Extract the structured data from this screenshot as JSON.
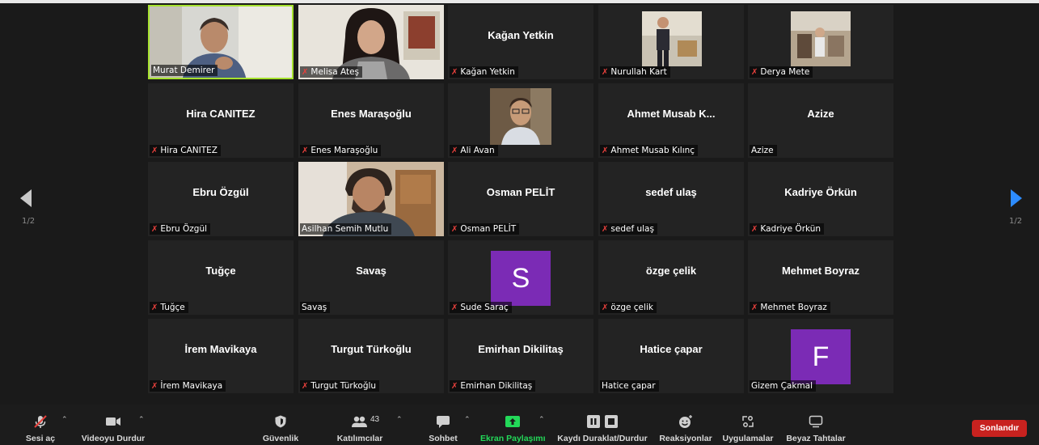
{
  "pagination": {
    "left": "1/2",
    "right": "1/2"
  },
  "tiles": [
    {
      "name": "Murat Demirer",
      "label": "Murat Demirer",
      "muted": false,
      "video": true,
      "active": true
    },
    {
      "name": "Melisa Ateş",
      "label": "Melisa Ateş",
      "muted": true,
      "video": true
    },
    {
      "name": "Kağan Yetkin",
      "label": "Kağan Yetkin",
      "muted": true,
      "video": false
    },
    {
      "name": "Nurullah Kart",
      "label": "Nurullah Kart",
      "muted": true,
      "video": true
    },
    {
      "name": "Derya Mete",
      "label": "Derya Mete",
      "muted": true,
      "video": true
    },
    {
      "name": "Hira CANITEZ",
      "label": "Hira CANITEZ",
      "muted": true,
      "video": false
    },
    {
      "name": "Enes Maraşoğlu",
      "label": "Enes Maraşoğlu",
      "muted": true,
      "video": false
    },
    {
      "name": "Ali Avan",
      "label": "Ali Avan",
      "muted": true,
      "video": true
    },
    {
      "name": "Ahmet Musab K...",
      "label": "Ahmet Musab Kılınç",
      "muted": true,
      "video": false
    },
    {
      "name": "Azize",
      "label": "Azize",
      "muted": false,
      "video": false
    },
    {
      "name": "Ebru Özgül",
      "label": "Ebru Özgül",
      "muted": true,
      "video": false
    },
    {
      "name": "Asilhan Semih Mutlu",
      "label": "Asilhan Semih Mutlu",
      "muted": false,
      "video": true
    },
    {
      "name": "Osman PELİT",
      "label": "Osman PELİT",
      "muted": true,
      "video": false
    },
    {
      "name": "sedef ulaş",
      "label": "sedef ulaş",
      "muted": true,
      "video": false
    },
    {
      "name": "Kadriye Örkün",
      "label": "Kadriye Örkün",
      "muted": true,
      "video": false
    },
    {
      "name": "Tuğçe",
      "label": "Tuğçe",
      "muted": true,
      "video": false
    },
    {
      "name": "Savaş",
      "label": "Savaş",
      "muted": false,
      "video": false
    },
    {
      "name": "Sude Saraç",
      "label": "Sude Saraç",
      "muted": true,
      "avatar": "S"
    },
    {
      "name": "özge çelik",
      "label": "özge çelik",
      "muted": true,
      "video": false
    },
    {
      "name": "Mehmet Boyraz",
      "label": "Mehmet Boyraz",
      "muted": true,
      "video": false
    },
    {
      "name": "İrem Mavikaya",
      "label": "İrem Mavikaya",
      "muted": true,
      "video": false
    },
    {
      "name": "Turgut Türkoğlu",
      "label": "Turgut Türkoğlu",
      "muted": true,
      "video": false
    },
    {
      "name": "Emirhan Dikilitaş",
      "label": "Emirhan Dikilitaş",
      "muted": true,
      "video": false
    },
    {
      "name": "Hatice çapar",
      "label": "Hatice çapar",
      "muted": false,
      "video": false
    },
    {
      "name": "Gizem Çakmal",
      "label": "Gizem Çakmal",
      "muted": false,
      "avatar": "F"
    }
  ],
  "toolbar": {
    "unmute": "Sesi aç",
    "stop_video": "Videoyu Durdur",
    "security": "Güvenlik",
    "participants": "Katılımcılar",
    "participants_count": "43",
    "chat": "Sohbet",
    "share_screen": "Ekran Paylaşımı",
    "record": "Kaydı Duraklat/Durdur",
    "reactions": "Reaksiyonlar",
    "apps": "Uygulamalar",
    "whiteboards": "Beyaz Tahtalar",
    "end": "Sonlandır"
  },
  "colors": {
    "accent": "#2d8cff",
    "share": "#23d959",
    "end": "#c8221f",
    "mute": "#e8403c",
    "avatar": "#7b2bb5",
    "active_border": "#a6e22e"
  }
}
